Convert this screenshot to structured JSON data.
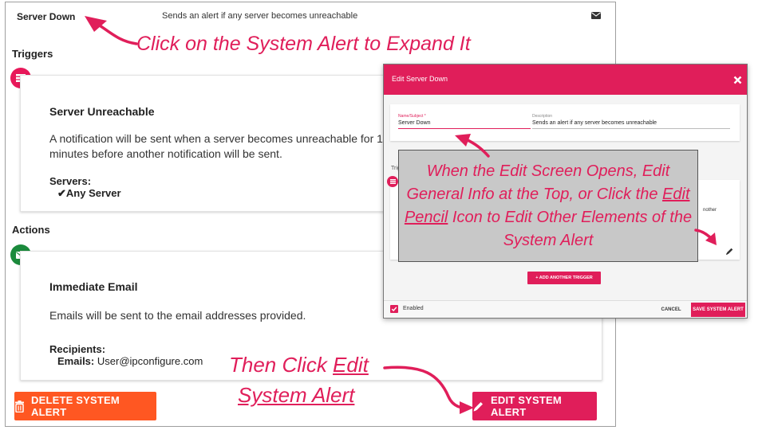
{
  "alert": {
    "name": "Server Down",
    "description": "Sends an alert if any server becomes unreachable",
    "header_icon": "mail-icon"
  },
  "triggers": {
    "title": "Triggers",
    "icon": "list-icon",
    "card": {
      "title": "Server Unreachable",
      "text_line1": "A notification will be sent when a server becomes unreachable for 1 mi",
      "text_line2": "minutes before another notification will be sent.",
      "servers_label": "Servers:",
      "servers_value": "✔Any Server"
    }
  },
  "actions": {
    "title": "Actions",
    "icon": "mail-icon",
    "card": {
      "title": "Immediate Email",
      "text": "Emails will be sent to the email addresses provided.",
      "recipients_label": "Recipients:",
      "emails_label": "Emails:",
      "emails_value": "User@ipconfigure.com"
    }
  },
  "buttons": {
    "delete_label": "DELETE SYSTEM ALERT",
    "edit_label": "EDIT SYSTEM ALERT"
  },
  "dialog": {
    "title": "Edit Server Down",
    "name_label": "Name/Subject *",
    "name_value": "Server Down",
    "description_label": "Description",
    "description_value": "Sends an alert if any server becomes unreachable",
    "triggers_fragment": "Trig",
    "card_fragment": "nother",
    "add_trigger_label": "+ ADD ANOTHER TRIGGER",
    "enabled_label": "Enabled",
    "cancel_label": "CANCEL",
    "save_label": "SAVE SYSTEM ALERT"
  },
  "annotations": {
    "top": "Click on the System Alert to Expand It",
    "callout_pre": "When the Edit Screen Opens, Edit General Info at the Top, or Click the ",
    "callout_link": "Edit Pencil",
    "callout_post": " Icon to Edit Other Elements of the System Alert",
    "bottom_pre": "Then Click ",
    "bottom_link": "Edit",
    "bottom_line2": "System Alert"
  },
  "colors": {
    "accent": "#e01e5a",
    "delete": "#ff5722",
    "success": "#1b8a3c",
    "callout_bg": "#c8c8c8"
  }
}
